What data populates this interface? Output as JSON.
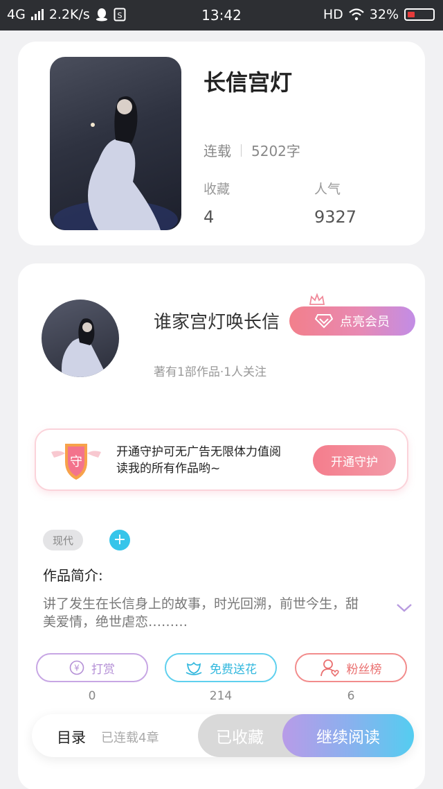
{
  "status_bar": {
    "network": "4G",
    "speed": "2.2K/s",
    "time": "13:42",
    "hd": "HD",
    "battery": "32%"
  },
  "book": {
    "title": "长信宫灯",
    "status": "连载",
    "word_count": "5202字",
    "stats": [
      {
        "label": "收藏",
        "value": "4"
      },
      {
        "label": "人气",
        "value": "9327"
      }
    ]
  },
  "author": {
    "name": "谁家宫灯唤长信",
    "meta": "著有1部作品·1人关注",
    "vip_label": "点亮会员"
  },
  "guard": {
    "badge_char": "守",
    "text": "开通守护可无广告无限体力值阅读我的所有作品哟~",
    "button": "开通守护"
  },
  "tags": {
    "items": [
      "现代"
    ],
    "add": "+"
  },
  "intro": {
    "heading": "作品简介:",
    "body": "讲了发生在长信身上的故事，时光回溯，前世今生，甜美爱情，绝世虐恋………"
  },
  "actions": [
    {
      "label": "打赏",
      "count": "0",
      "icon": "yen-coin-icon"
    },
    {
      "label": "免费送花",
      "count": "214",
      "icon": "flower-icon"
    },
    {
      "label": "粉丝榜",
      "count": "6",
      "icon": "fan-user-icon"
    }
  ],
  "bottom_bar": {
    "toc": "目录",
    "chapters": "已连载4章",
    "favorited": "已收藏",
    "continue": "继续阅读"
  },
  "colors": {
    "accent_pink": "#f47d8c",
    "accent_purple": "#c28de6",
    "accent_cyan": "#36c5ea"
  }
}
